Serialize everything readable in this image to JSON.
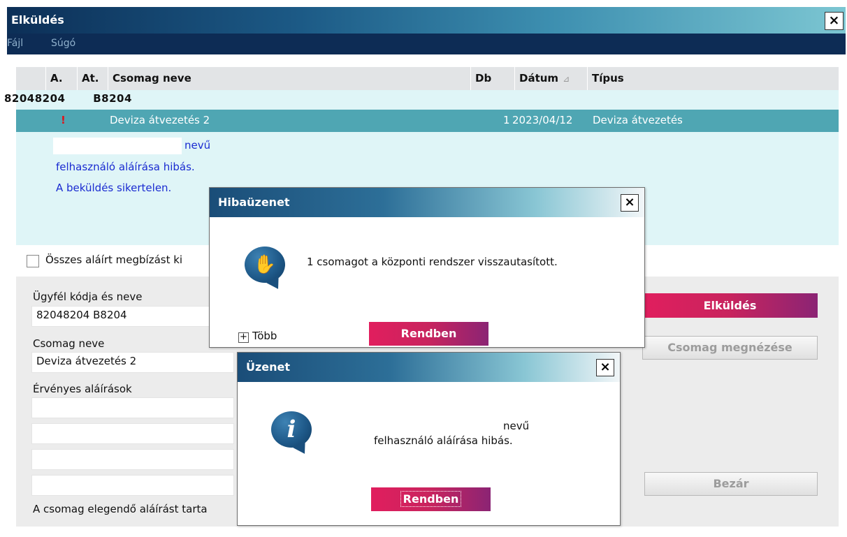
{
  "window": {
    "title": "Elküldés",
    "close_label": "×"
  },
  "menu": {
    "items": [
      "Fájl",
      "Súgó"
    ]
  },
  "grid": {
    "columns": [
      "A.",
      "At.",
      "Csomag neve",
      "Db",
      "Dátum",
      "Típus"
    ],
    "sort_indicator": "⊿",
    "group": {
      "code": "82048204",
      "name": "B8204"
    },
    "selected_row": {
      "status_mark": "!",
      "name": "Deviza átvezetés 2",
      "db": "1",
      "date": "2023/04/12",
      "type": "Deviza átvezetés"
    },
    "error_lines": [
      "nevű",
      "felhasználó aláírása hibás.",
      "A beküldés sikertelen."
    ]
  },
  "checkbox": {
    "label": "Összes aláírt megbízást ki",
    "checked": false
  },
  "form": {
    "client_label": "Ügyfél kódja és neve",
    "client_value": "82048204  B8204",
    "package_label": "Csomag neve",
    "package_value": "Deviza átvezetés 2",
    "signatures_label": "Érvényes aláírások",
    "footer_text": "A csomag elegendő aláírást tarta"
  },
  "buttons": {
    "send": "Elküldés",
    "view": "Csomag megnézése",
    "close": "Bezár"
  },
  "error_dialog": {
    "title": "Hibaüzenet",
    "close_label": "×",
    "message": "1 csomagot a központi rendszer visszautasított.",
    "more_toggle": "+",
    "more_label": "Több",
    "ok_label": "Rendben",
    "icon": "hand-stop-icon"
  },
  "message_dialog": {
    "title": "Üzenet",
    "close_label": "×",
    "line1": "nevű",
    "line2": "felhasználó aláírása hibás.",
    "ok_label": "Rendben",
    "icon": "info-icon",
    "icon_glyph": "i"
  },
  "colors": {
    "accent_pink": "#e11e5e",
    "accent_purple": "#8b2474",
    "titlebar_dark": "#0c2f57",
    "selection_teal": "#4fa6b3",
    "error_text_blue": "#1a2bd1"
  }
}
